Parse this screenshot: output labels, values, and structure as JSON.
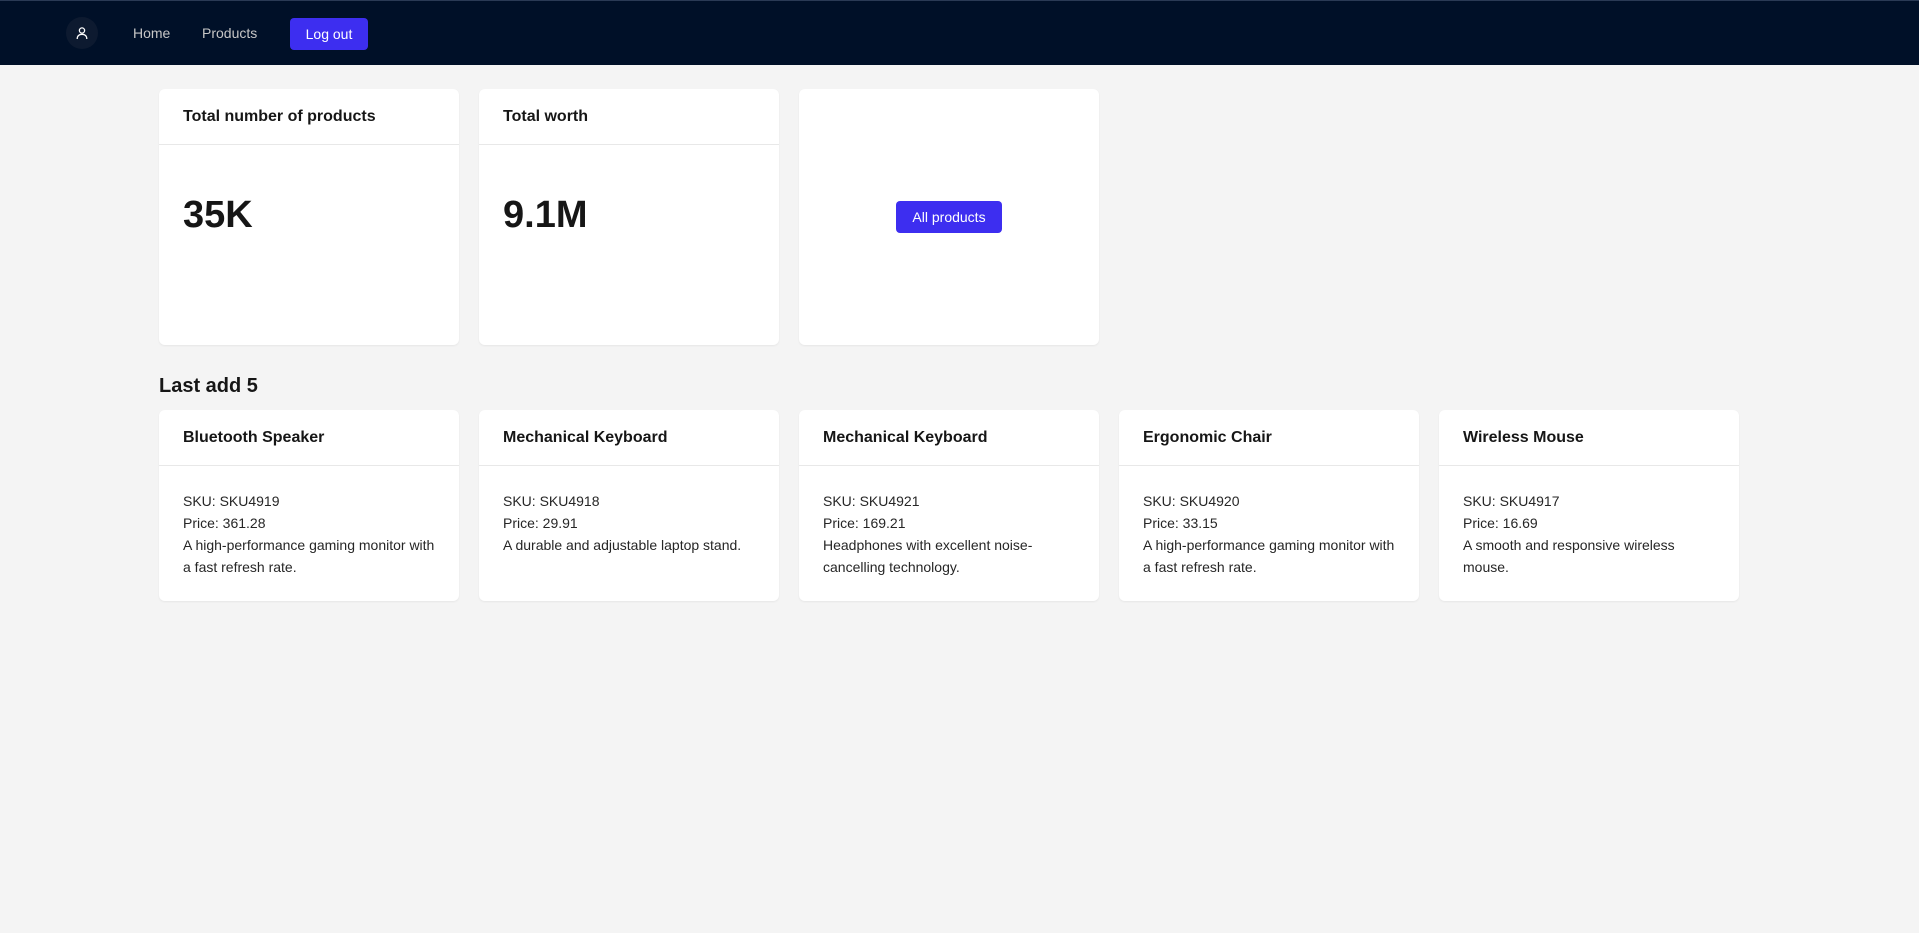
{
  "nav": {
    "home": "Home",
    "products": "Products",
    "logout": "Log out"
  },
  "stats": {
    "total_products_label": "Total number of products",
    "total_products_value": "35K",
    "total_worth_label": "Total worth",
    "total_worth_value": "9.1M",
    "all_products_button": "All products"
  },
  "section": {
    "title": "Last add 5"
  },
  "products": [
    {
      "name": "Bluetooth Speaker",
      "sku": "SKU: SKU4919",
      "price": "Price: 361.28",
      "description": "A high-performance gaming monitor with a fast refresh rate."
    },
    {
      "name": "Mechanical Keyboard",
      "sku": "SKU: SKU4918",
      "price": "Price: 29.91",
      "description": "A durable and adjustable laptop stand."
    },
    {
      "name": "Mechanical Keyboard",
      "sku": "SKU: SKU4921",
      "price": "Price: 169.21",
      "description": "Headphones with excellent noise-cancelling technology."
    },
    {
      "name": "Ergonomic Chair",
      "sku": "SKU: SKU4920",
      "price": "Price: 33.15",
      "description": "A high-performance gaming monitor with a fast refresh rate."
    },
    {
      "name": "Wireless Mouse",
      "sku": "SKU: SKU4917",
      "price": "Price: 16.69",
      "description": "A smooth and responsive wireless mouse."
    }
  ],
  "icons": {
    "avatar": "user-icon"
  },
  "colors": {
    "navbar": "#001028",
    "accent": "#3d2ef0",
    "background": "#f4f4f4"
  }
}
